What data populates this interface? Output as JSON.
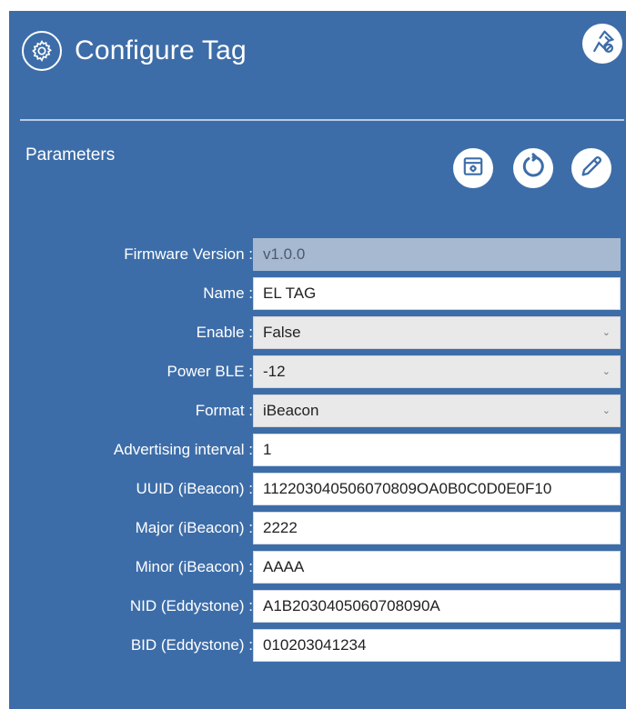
{
  "header": {
    "title": "Configure Tag",
    "title_icon": "gear-icon",
    "pin_icon": "unpin-icon"
  },
  "section": {
    "label": "Parameters"
  },
  "toolbar": {
    "icons": [
      "calendar-settings-icon",
      "refresh-icon",
      "edit-icon"
    ]
  },
  "fields": [
    {
      "label": "Firmware Version :",
      "value": "v1.0.0",
      "kind": "readonly"
    },
    {
      "label": "Name :",
      "value": "EL TAG",
      "kind": "text"
    },
    {
      "label": "Enable :",
      "value": "False",
      "kind": "select"
    },
    {
      "label": "Power BLE :",
      "value": "-12",
      "kind": "select"
    },
    {
      "label": "Format :",
      "value": "iBeacon",
      "kind": "select"
    },
    {
      "label": "Advertising interval :",
      "value": "1",
      "kind": "text"
    },
    {
      "label": "UUID (iBeacon) :",
      "value": "112203040506070809OA0B0C0D0E0F10",
      "kind": "text"
    },
    {
      "label": "Major (iBeacon) :",
      "value": "2222",
      "kind": "text"
    },
    {
      "label": "Minor (iBeacon) :",
      "value": "AAAA",
      "kind": "text"
    },
    {
      "label": "NID (Eddystone) :",
      "value": "A1B2030405060708090A",
      "kind": "text"
    },
    {
      "label": "BID (Eddystone) :",
      "value": "010203041234",
      "kind": "text"
    }
  ],
  "colors": {
    "panel": "#3d6da8",
    "readonly_field": "#a7b9d0",
    "select_field": "#e9e9e9",
    "text": "#ffffff"
  }
}
